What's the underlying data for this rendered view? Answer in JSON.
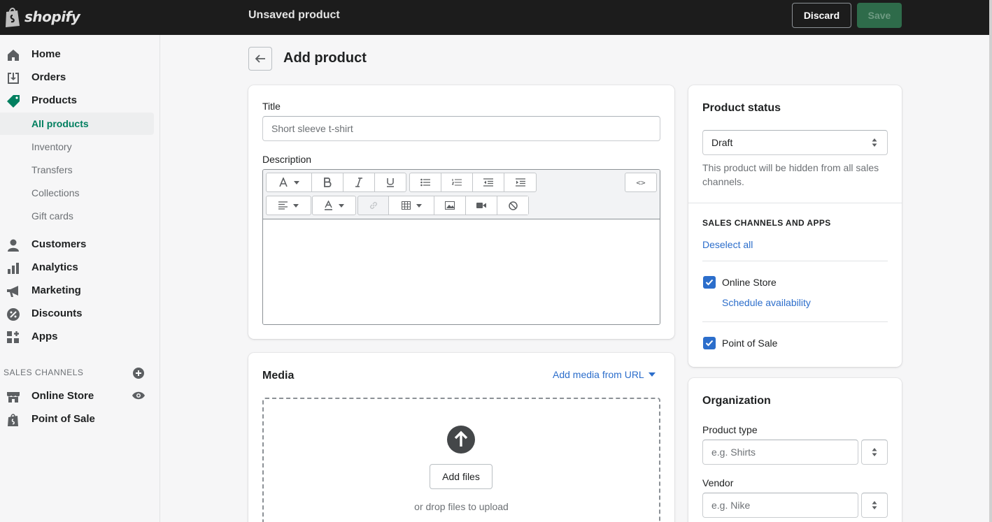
{
  "topbar": {
    "logo_text": "shopify",
    "page_title": "Unsaved product",
    "discard_label": "Discard",
    "save_label": "Save"
  },
  "sidebar": {
    "items": [
      {
        "label": "Home",
        "icon": "home-icon"
      },
      {
        "label": "Orders",
        "icon": "orders-icon"
      },
      {
        "label": "Products",
        "icon": "tag-icon"
      },
      {
        "label": "Customers",
        "icon": "person-icon"
      },
      {
        "label": "Analytics",
        "icon": "bar-chart-icon"
      },
      {
        "label": "Marketing",
        "icon": "megaphone-icon"
      },
      {
        "label": "Discounts",
        "icon": "discount-icon"
      },
      {
        "label": "Apps",
        "icon": "apps-icon"
      }
    ],
    "sub_items": [
      "All products",
      "Inventory",
      "Transfers",
      "Collections",
      "Gift cards"
    ],
    "sales_channels_heading": "SALES CHANNELS",
    "channels": [
      {
        "label": "Online Store",
        "icon": "store-icon"
      },
      {
        "label": "Point of Sale",
        "icon": "pos-bag-icon"
      }
    ],
    "accent_color": "#007f5f"
  },
  "page": {
    "title": "Add product"
  },
  "product_form": {
    "title_label": "Title",
    "title_placeholder": "Short sleeve t-shirt",
    "description_label": "Description",
    "html_toggle": "<>"
  },
  "media": {
    "heading": "Media",
    "add_from_url": "Add media from URL",
    "add_files": "Add files",
    "drop_hint": "or drop files to upload"
  },
  "status": {
    "heading": "Product status",
    "selected": "Draft",
    "help": "This product will be hidden from all sales channels.",
    "channels_heading": "SALES CHANNELS AND APPS",
    "deselect_all": "Deselect all",
    "online_store": "Online Store",
    "online_store_checked": true,
    "schedule": "Schedule availability",
    "pos": "Point of Sale",
    "pos_checked": true
  },
  "organization": {
    "heading": "Organization",
    "type_label": "Product type",
    "type_placeholder": "e.g. Shirts",
    "vendor_label": "Vendor",
    "vendor_placeholder": "e.g. Nike"
  },
  "colors": {
    "topbar": "#1c1c1c",
    "primary_disabled": "#2e6b4a",
    "link": "#2c6ecb",
    "checkbox": "#2c6ecb"
  }
}
